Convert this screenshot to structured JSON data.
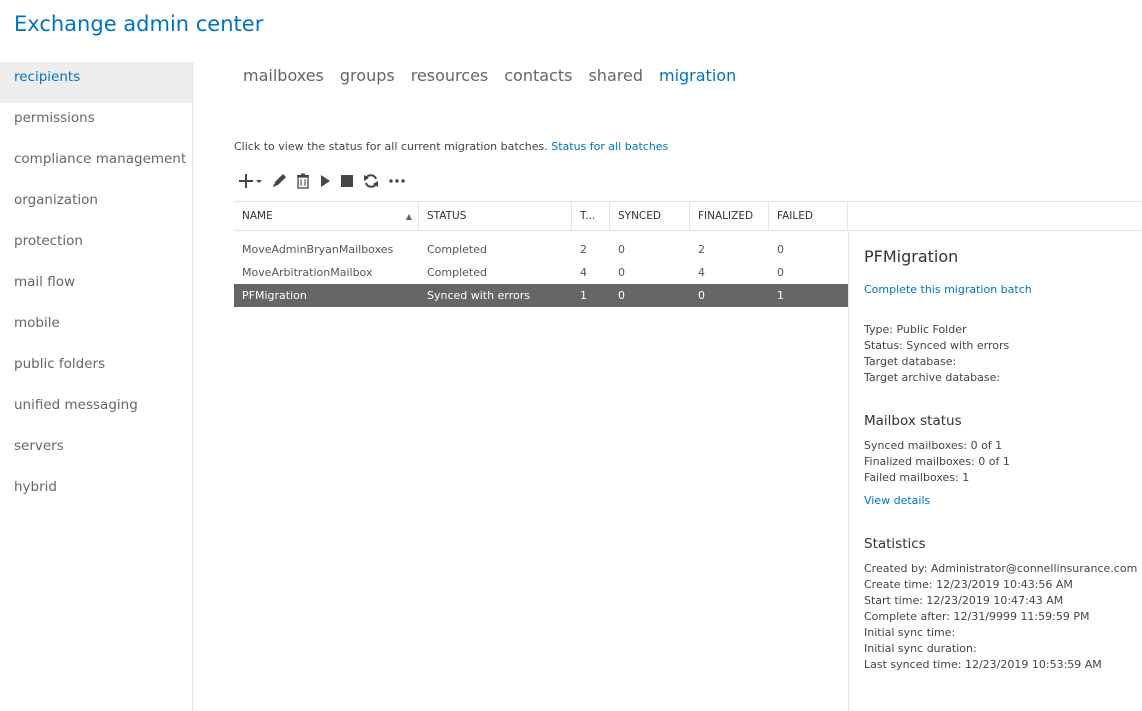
{
  "app": {
    "title": "Exchange admin center"
  },
  "sidebar": {
    "items": [
      {
        "label": "recipients"
      },
      {
        "label": "permissions"
      },
      {
        "label": "compliance management"
      },
      {
        "label": "organization"
      },
      {
        "label": "protection"
      },
      {
        "label": "mail flow"
      },
      {
        "label": "mobile"
      },
      {
        "label": "public folders"
      },
      {
        "label": "unified messaging"
      },
      {
        "label": "servers"
      },
      {
        "label": "hybrid"
      }
    ],
    "active": "recipients"
  },
  "tabs": [
    {
      "label": "mailboxes"
    },
    {
      "label": "groups"
    },
    {
      "label": "resources"
    },
    {
      "label": "contacts"
    },
    {
      "label": "shared"
    },
    {
      "label": "migration"
    }
  ],
  "active_tab": "migration",
  "info": {
    "text": "Click to view the status for all current migration batches.",
    "link": "Status for all batches"
  },
  "toolbar": {
    "icons": [
      "add-icon",
      "edit-icon",
      "delete-icon",
      "start-icon",
      "stop-icon",
      "refresh-icon",
      "more-icon"
    ]
  },
  "grid": {
    "columns": [
      "NAME",
      "STATUS",
      "T...",
      "SYNCED",
      "FINALIZED",
      "FAILED"
    ],
    "rows": [
      {
        "name": "MoveAdminBryanMailboxes",
        "status": "Completed",
        "total": "2",
        "synced": "0",
        "finalized": "2",
        "failed": "0"
      },
      {
        "name": "MoveArbitrationMailbox",
        "status": "Completed",
        "total": "4",
        "synced": "0",
        "finalized": "4",
        "failed": "0"
      },
      {
        "name": "PFMigration",
        "status": "Synced with errors",
        "total": "1",
        "synced": "0",
        "finalized": "0",
        "failed": "1"
      }
    ],
    "selected_index": 2
  },
  "details": {
    "title": "PFMigration",
    "action_link": "Complete this migration batch",
    "type": "Type: Public Folder",
    "status": "Status: Synced with errors",
    "target_db": "Target database:",
    "target_archive_db": "Target archive database:",
    "mailbox_status_heading": "Mailbox status",
    "synced_mailboxes": "Synced mailboxes: 0 of 1",
    "finalized_mailboxes": "Finalized mailboxes: 0 of 1",
    "failed_mailboxes": "Failed mailboxes: 1",
    "view_details": "View details",
    "statistics_heading": "Statistics",
    "created_by": "Created by: Administrator@connellinsurance.com",
    "create_time": "Create time: 12/23/2019 10:43:56 AM",
    "start_time": "Start time: 12/23/2019 10:47:43 AM",
    "complete_after": "Complete after: 12/31/9999 11:59:59 PM",
    "initial_sync_time": "Initial sync time:",
    "initial_sync_duration": "Initial sync duration:",
    "last_synced_time": "Last synced time: 12/23/2019 10:53:59 AM"
  },
  "colors": {
    "accent": "#0072c6",
    "selected_row": "#666666",
    "sidebar_active_bg": "#eeeeee"
  }
}
